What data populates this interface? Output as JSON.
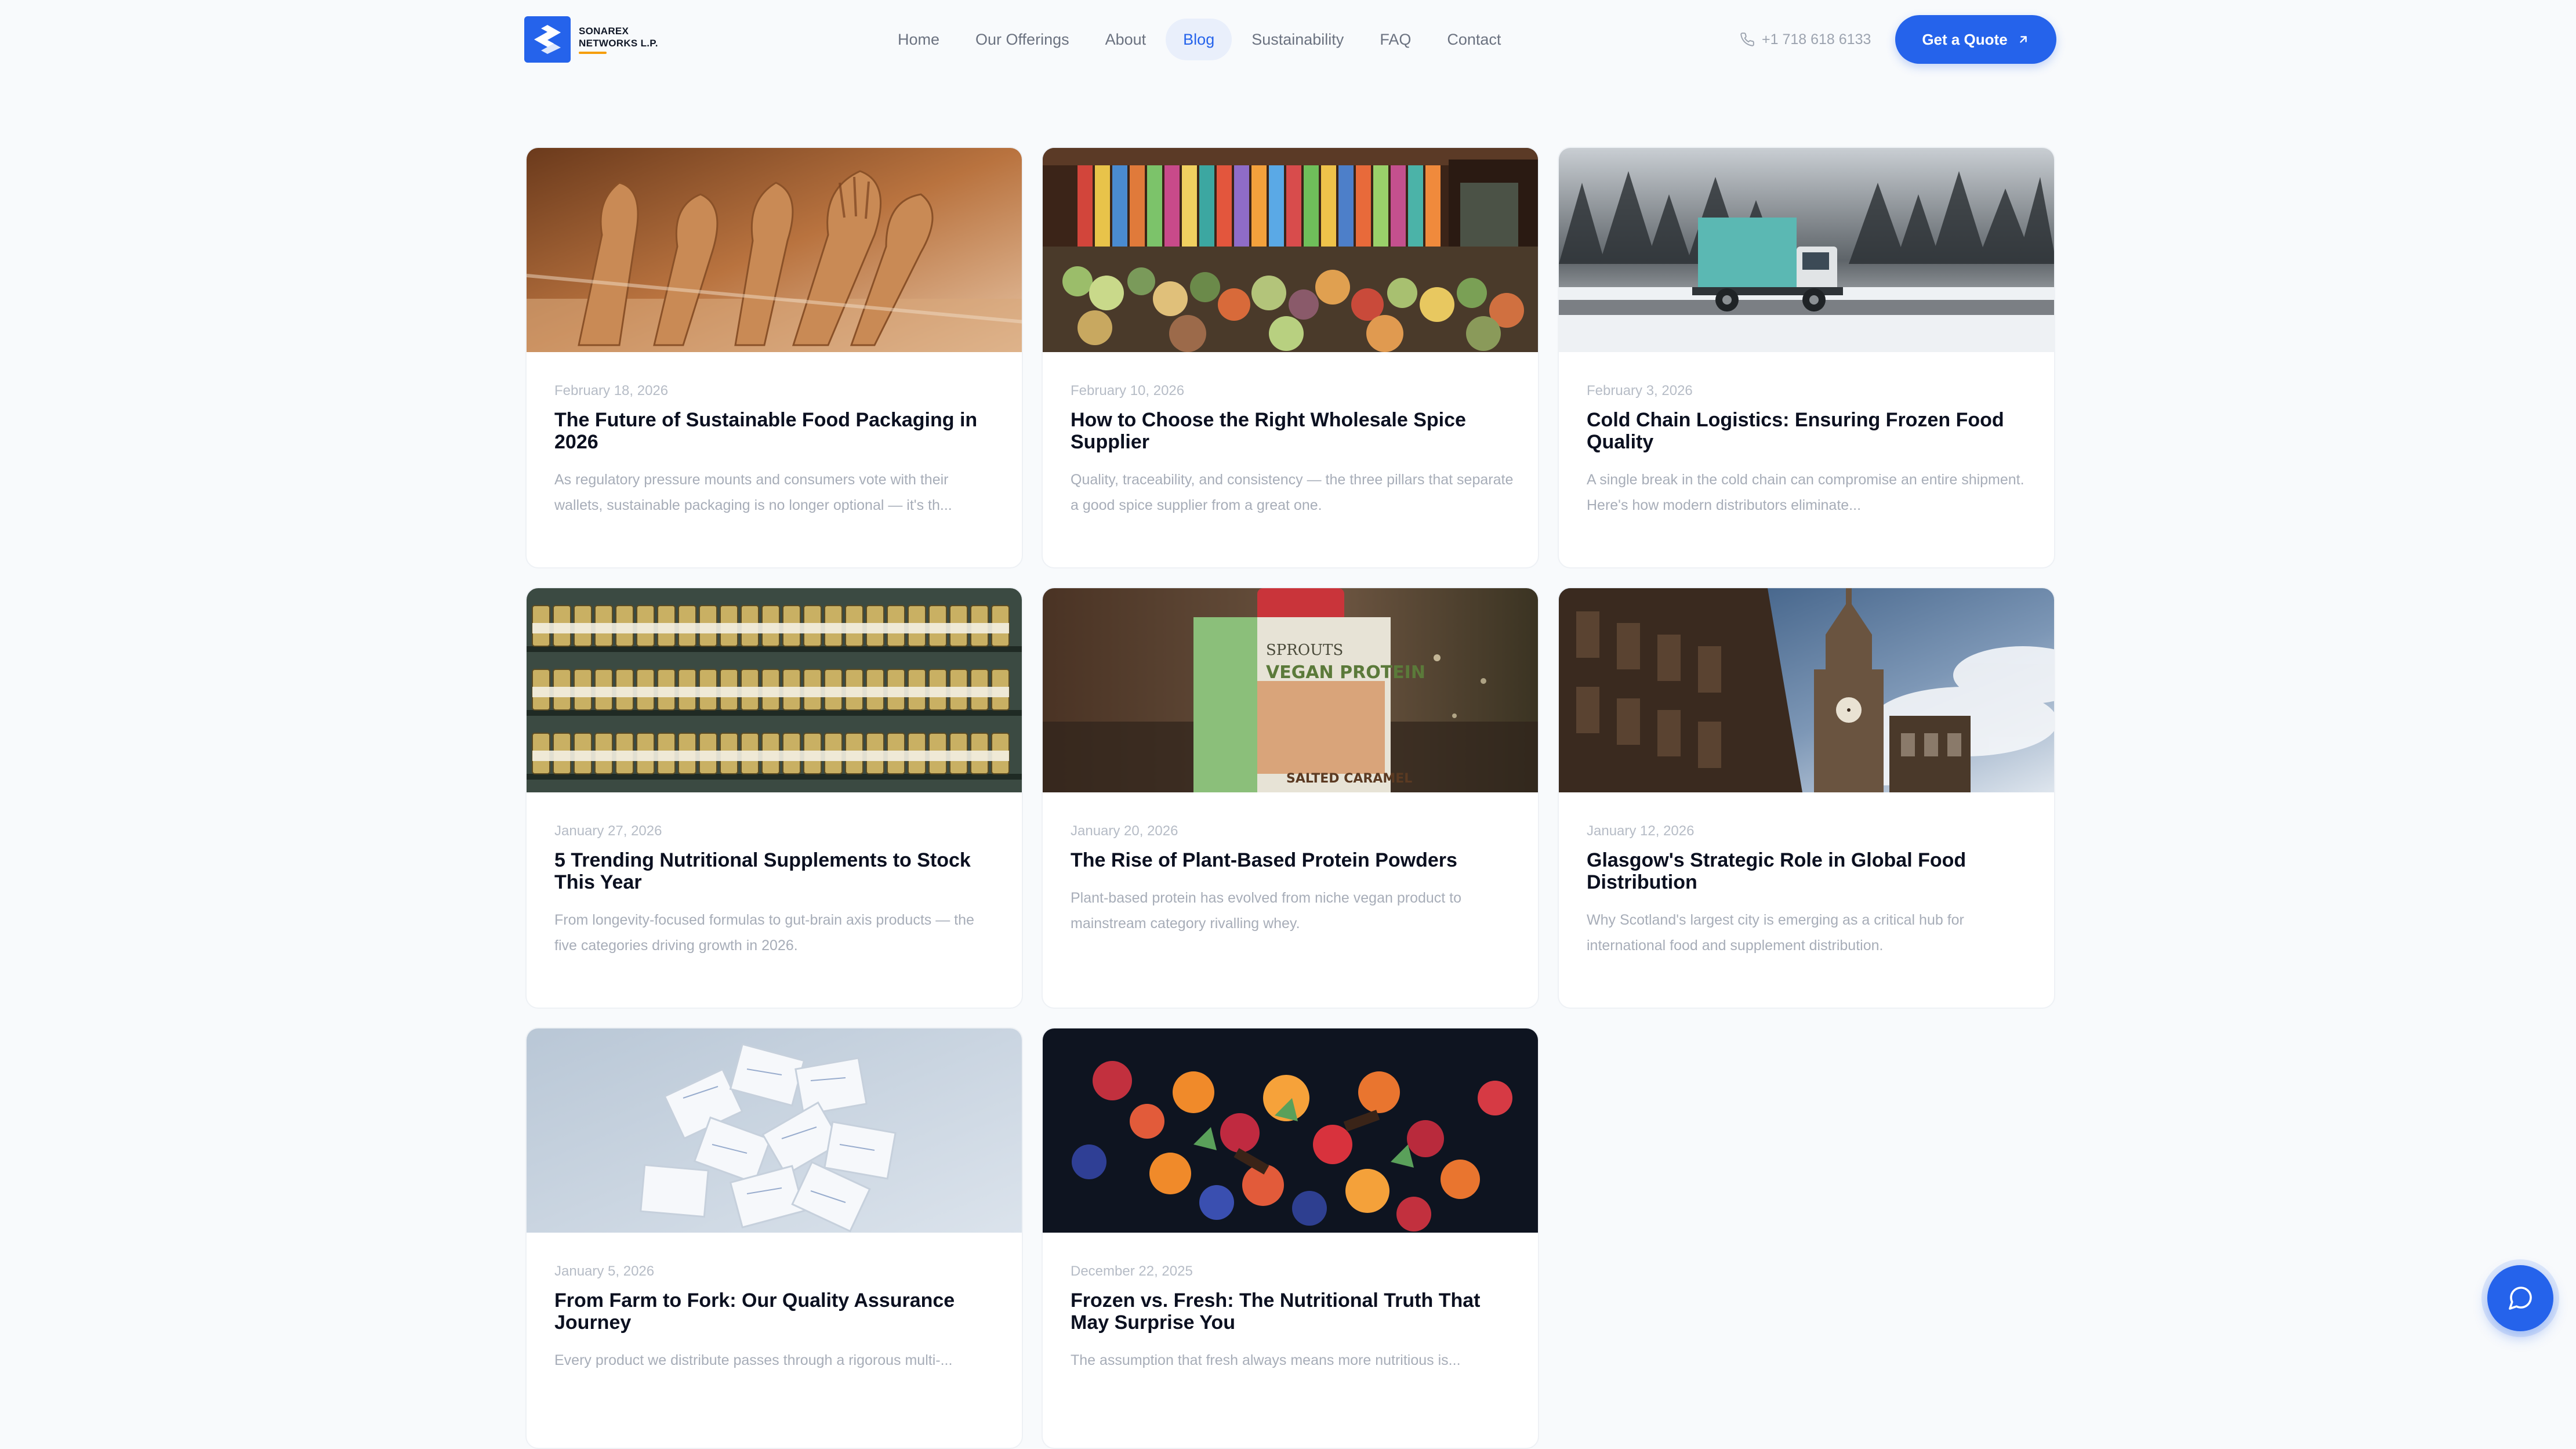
{
  "brand": {
    "name_line1": "SONAREX",
    "name_line2": "NETWORKS L.P.",
    "accent": "#2563eb",
    "underline": "#f59e0b"
  },
  "nav": {
    "items": [
      {
        "label": "Home",
        "active": false
      },
      {
        "label": "Our Offerings",
        "active": false
      },
      {
        "label": "About",
        "active": false
      },
      {
        "label": "Blog",
        "active": true
      },
      {
        "label": "Sustainability",
        "active": false
      },
      {
        "label": "FAQ",
        "active": false
      },
      {
        "label": "Contact",
        "active": false
      }
    ]
  },
  "header": {
    "phone_icon": "phone-icon",
    "phone": "+1 718 618 6133",
    "cta_label": "Get a Quote",
    "cta_icon": "arrow-up-right-icon"
  },
  "posts": [
    {
      "date": "February 18, 2026",
      "title": "The Future of Sustainable Food Packaging in 2026",
      "excerpt": "As regulatory pressure mounts and consumers vote with their wallets, sustainable packaging is no longer optional — it's th...",
      "image": "wooden-cutlery-photo"
    },
    {
      "date": "February 10, 2026",
      "title": "How to Choose the Right Wholesale Spice Supplier",
      "excerpt": "Quality, traceability, and consistency — the three pillars that separate a good spice supplier from a great one.",
      "image": "produce-market-photo"
    },
    {
      "date": "February 3, 2026",
      "title": "Cold Chain Logistics: Ensuring Frozen Food Quality",
      "excerpt": "A single break in the cold chain can compromise an entire shipment. Here's how modern distributors eliminate...",
      "image": "delivery-truck-snow-photo"
    },
    {
      "date": "January 27, 2026",
      "title": "5 Trending Nutritional Supplements to Stock This Year",
      "excerpt": "From longevity-focused formulas to gut-brain axis products — the five categories driving growth in 2026.",
      "image": "supplement-shelves-photo"
    },
    {
      "date": "January 20, 2026",
      "title": "The Rise of Plant-Based Protein Powders",
      "excerpt": "Plant-based protein has evolved from niche vegan product to mainstream category rivalling whey.",
      "image": "vegan-protein-packet-photo",
      "image_text": {
        "brand": "SPROUTS",
        "product": "VEGAN PROTEIN",
        "flavor": "SALTED CARAMEL"
      }
    },
    {
      "date": "January 12, 2026",
      "title": "Glasgow's Strategic Role in Global Food Distribution",
      "excerpt": "Why Scotland's largest city is emerging as a critical hub for international food and supplement distribution.",
      "image": "glasgow-architecture-photo"
    },
    {
      "date": "January 5, 2026",
      "title": "From Farm to Fork: Our Quality Assurance Journey",
      "excerpt": "Every product we distribute passes through a rigorous multi-...",
      "image": "desiccant-packets-photo"
    },
    {
      "date": "December 22, 2025",
      "title": "Frozen vs. Fresh: The Nutritional Truth That May Surprise You",
      "excerpt": "The assumption that fresh always means more nutritious is...",
      "image": "fresh-fruit-bowl-photo"
    }
  ],
  "chat": {
    "icon": "chat-bubble-icon"
  }
}
